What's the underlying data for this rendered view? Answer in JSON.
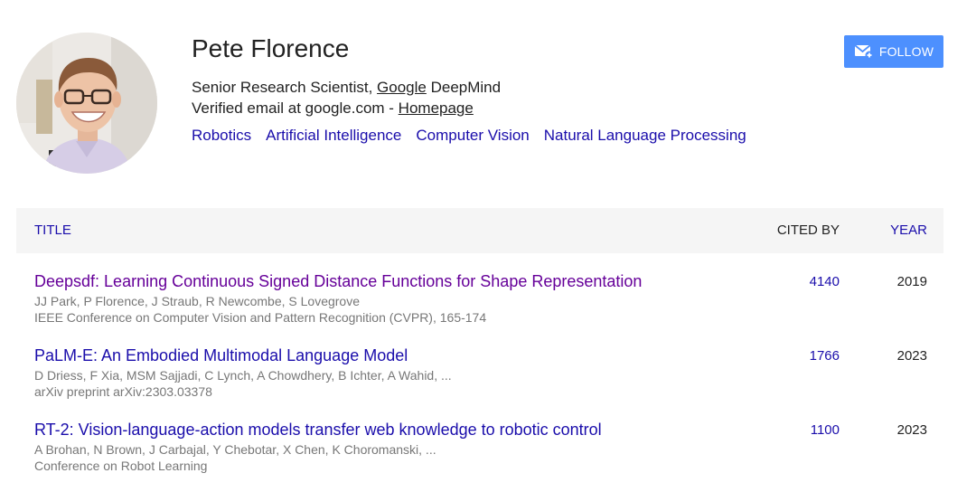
{
  "profile": {
    "name": "Pete Florence",
    "affiliation_prefix": "Senior Research Scientist, ",
    "affiliation_link": "Google",
    "affiliation_suffix": " DeepMind",
    "email_text": "Verified email at google.com - ",
    "homepage_link": "Homepage",
    "interests": [
      "Robotics",
      "Artificial Intelligence",
      "Computer Vision",
      "Natural Language Processing"
    ],
    "avatar_icon": "profile-photo"
  },
  "follow": {
    "label": "FOLLOW",
    "icon": "mail-plus-icon",
    "color": "#4d90fe"
  },
  "table": {
    "headers": {
      "title": "TITLE",
      "cited_by": "CITED BY",
      "year": "YEAR"
    },
    "rows": [
      {
        "title": "Deepsdf: Learning Continuous Signed Distance Functions for Shape Representation",
        "authors": "JJ Park, P Florence, J Straub, R Newcombe, S Lovegrove",
        "venue": "IEEE Conference on Computer Vision and Pattern Recognition (CVPR), 165-174",
        "cited_by": "4140",
        "year": "2019"
      },
      {
        "title": "PaLM-E: An Embodied Multimodal Language Model",
        "authors": "D Driess, F Xia, MSM Sajjadi, C Lynch, A Chowdhery, B Ichter, A Wahid, ...",
        "venue": "arXiv preprint arXiv:2303.03378",
        "cited_by": "1766",
        "year": "2023"
      },
      {
        "title": "RT-2: Vision-language-action models transfer web knowledge to robotic control",
        "authors": "A Brohan, N Brown, J Carbajal, Y Chebotar, X Chen, K Choromanski, ...",
        "venue": "Conference on Robot Learning",
        "cited_by": "1100",
        "year": "2023"
      }
    ]
  },
  "colors": {
    "link": "#1a0dab",
    "visited": "#660099",
    "secondary_text": "#777777",
    "header_bg": "#f5f5f5"
  }
}
